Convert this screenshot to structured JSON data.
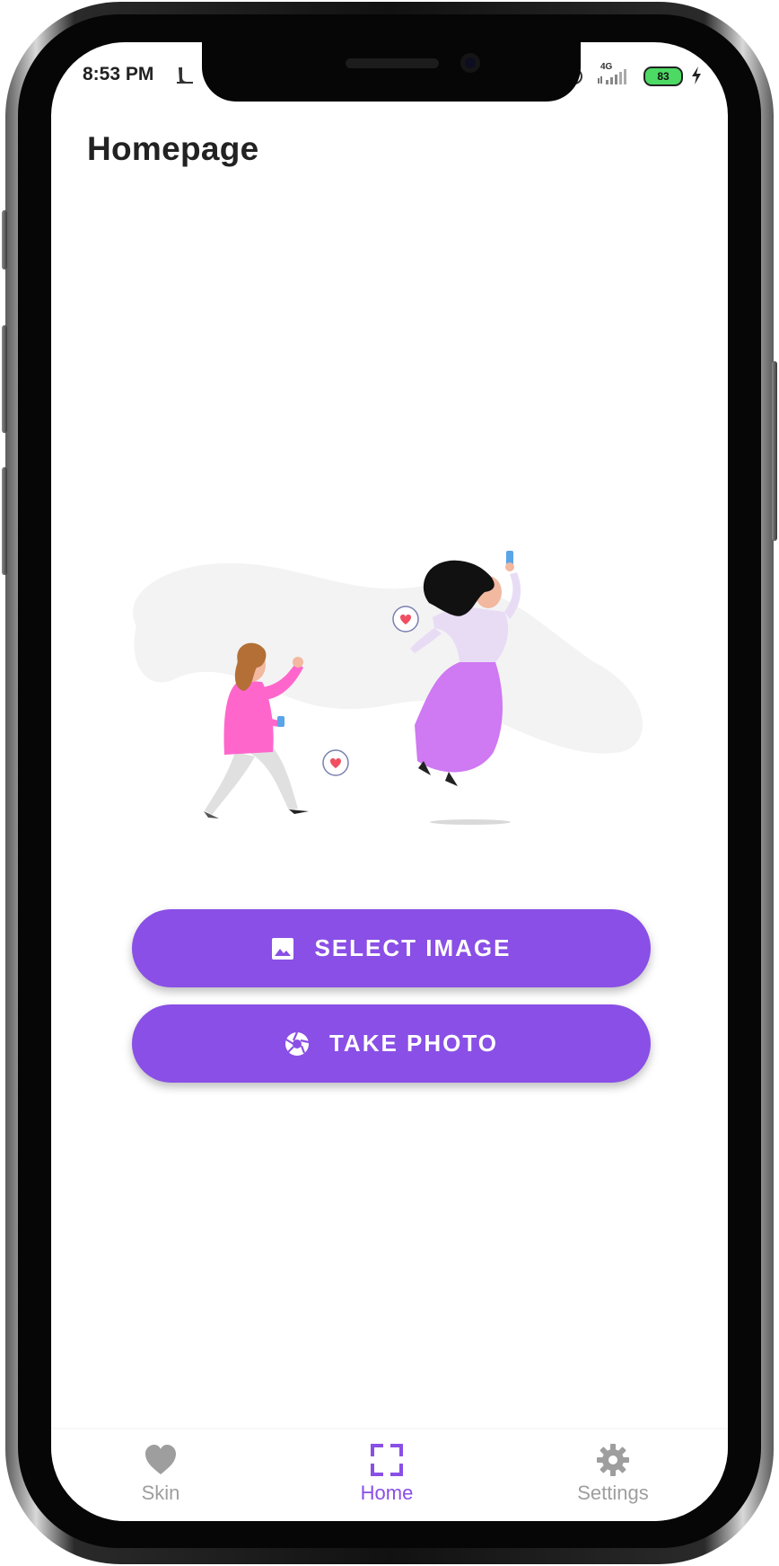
{
  "status_bar": {
    "time": "8:53 PM",
    "network": "4G",
    "battery": "83"
  },
  "page": {
    "title": "Homepage"
  },
  "actions": {
    "select_image_label": "SELECT IMAGE",
    "take_photo_label": "TAKE PHOTO"
  },
  "bottom_nav": {
    "items": [
      {
        "label": "Skin",
        "icon": "heart-icon",
        "active": false
      },
      {
        "label": "Home",
        "icon": "scan-frame-icon",
        "active": true
      },
      {
        "label": "Settings",
        "icon": "gear-icon",
        "active": false
      }
    ]
  },
  "colors": {
    "primary": "#8a4fe6",
    "nav_active": "#8a4fe6",
    "nav_inactive": "#9e9e9e",
    "title_text": "#222222"
  }
}
